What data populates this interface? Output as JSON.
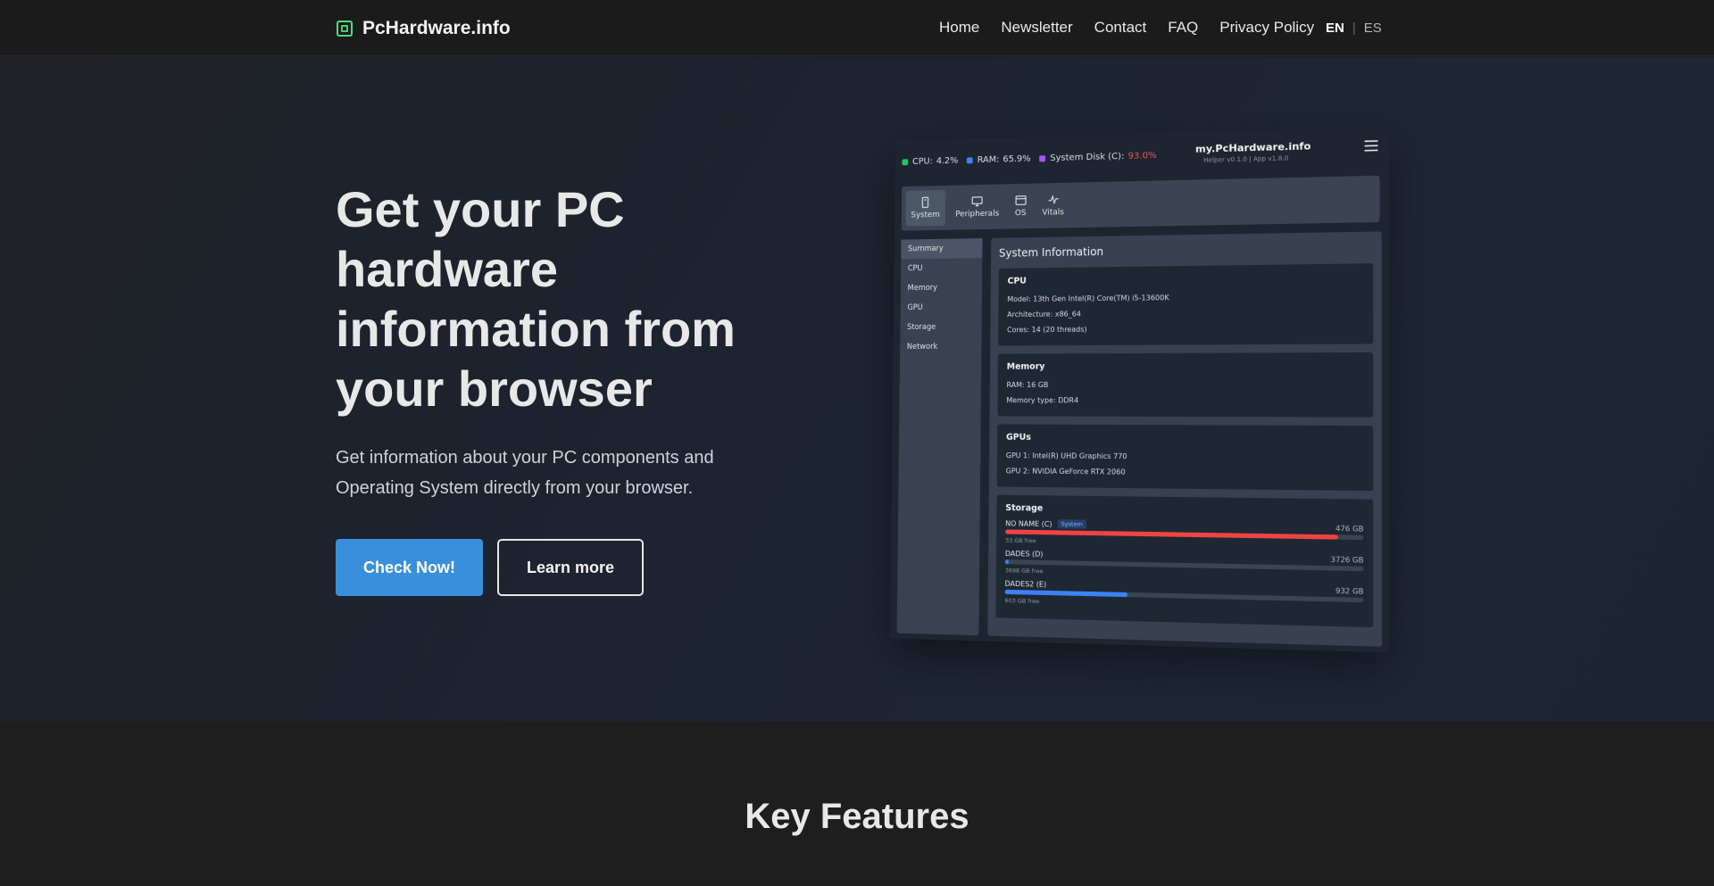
{
  "nav": {
    "brand": "PcHardware.info",
    "links": [
      "Home",
      "Newsletter",
      "Contact",
      "FAQ",
      "Privacy Policy"
    ],
    "lang_active": "EN",
    "lang_separator": "|",
    "lang_other": "ES"
  },
  "hero": {
    "title": "Get your PC hardware information from your browser",
    "subtitle": "Get information about your PC components and Operating System directly from your browser.",
    "cta_primary": "Check Now!",
    "cta_secondary": "Learn more"
  },
  "preview": {
    "stats": [
      {
        "label": "CPU:",
        "value": "4.2%",
        "color": "#22c55e",
        "alert": false
      },
      {
        "label": "RAM:",
        "value": "65.9%",
        "color": "#3b82f6",
        "alert": false
      },
      {
        "label": "System Disk (C):",
        "value": "93.0%",
        "color": "#a855f7",
        "alert": true
      }
    ],
    "brand_title": "my.PcHardware.info",
    "brand_sub": "Helper v0.1.0 | App v1.8.0",
    "tabs": [
      "System",
      "Peripherals",
      "OS",
      "Vitals"
    ],
    "sidebar": [
      "Summary",
      "CPU",
      "Memory",
      "GPU",
      "Storage",
      "Network"
    ],
    "main_title": "System Information",
    "cpu": {
      "title": "CPU",
      "lines": [
        "Model: 13th Gen Intel(R) Core(TM) i5-13600K",
        "Architecture: x86_64",
        "Cores: 14 (20 threads)"
      ]
    },
    "memory": {
      "title": "Memory",
      "lines": [
        "RAM: 16 GB",
        "Memory type: DDR4"
      ]
    },
    "gpus": {
      "title": "GPUs",
      "lines": [
        "GPU 1: Intel(R) UHD Graphics 770",
        "GPU 2: NVIDIA GeForce RTX 2060"
      ]
    },
    "storage": {
      "title": "Storage",
      "badge": "System",
      "drives": [
        {
          "name": "NO NAME (C)",
          "size": "476 GB",
          "free": "33 GB free",
          "used_pct": 93,
          "color": "#ef4444",
          "system": true
        },
        {
          "name": "DADES (D)",
          "size": "3726 GB",
          "free": "3698 GB free",
          "used_pct": 1,
          "color": "#3b82f6",
          "system": false
        },
        {
          "name": "DADES2 (E)",
          "size": "932 GB",
          "free": "603 GB free",
          "used_pct": 35,
          "color": "#3b82f6",
          "system": false
        }
      ]
    }
  },
  "features": {
    "title": "Key Features"
  }
}
